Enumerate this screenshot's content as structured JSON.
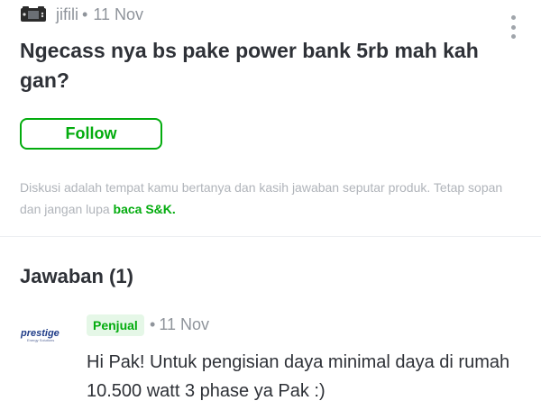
{
  "question": {
    "username": "jifili",
    "separator": "•",
    "date": "11 Nov",
    "text": "Ngecass nya bs pake power bank 5rb mah kah gan?",
    "avatar_icon": "gamepad-avatar-icon",
    "menu_icon": "more-vertical-icon"
  },
  "follow_label": "Follow",
  "notice": {
    "text": "Diskusi adalah tempat kamu bertanya dan kasih jawaban seputar produk. Tetap sopan dan jangan lupa ",
    "link": "baca S&K."
  },
  "answers": {
    "title": "Jawaban (1)",
    "items": [
      {
        "seller_logo_text": "prestige",
        "seller_logo_subtext": "Energy Solutions",
        "badge": "Penjual",
        "separator": "•",
        "date": "11 Nov",
        "text": "Hi Pak! Untuk pengisian daya minimal daya di rumah 10.500 watt 3 phase ya Pak :)"
      }
    ]
  },
  "colors": {
    "accent_green": "#03ac0e",
    "badge_bg": "#e5f7e7",
    "muted_text": "#8f949b",
    "primary_text": "#2e3137"
  }
}
